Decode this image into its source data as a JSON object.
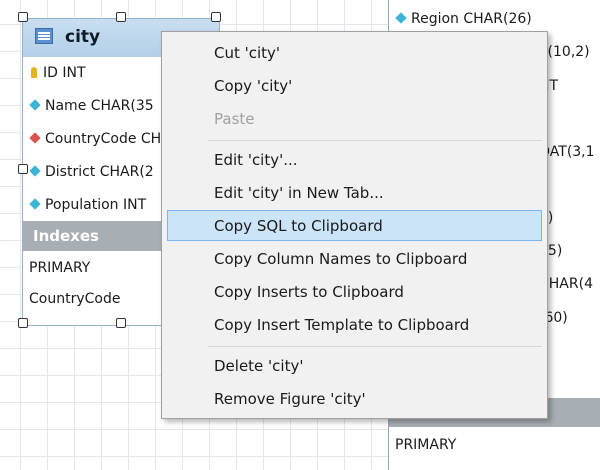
{
  "country_table": {
    "columns": [
      {
        "label": "Region CHAR(26)",
        "icon": "diamond-icon"
      },
      {
        "label": "T(10,2)"
      },
      {
        "label": "NT"
      },
      {
        "label": "OAT(3,1"
      },
      {
        "label": "2)"
      },
      {
        "label": "45)"
      },
      {
        "label": "CHAR(4"
      },
      {
        "label": "(60)"
      }
    ],
    "index_primary": "PRIMARY"
  },
  "city_table": {
    "title": "city",
    "columns": [
      {
        "label": "ID INT",
        "icon": "primary-key-icon"
      },
      {
        "label": "Name CHAR(35",
        "icon": "column-diamond-icon"
      },
      {
        "label": "CountryCode CH",
        "icon": "foreign-key-diamond-icon"
      },
      {
        "label": "District CHAR(2",
        "icon": "column-diamond-icon"
      },
      {
        "label": "Population INT",
        "icon": "column-diamond-icon"
      }
    ],
    "indexes_label": "Indexes",
    "indexes": [
      "PRIMARY",
      "CountryCode"
    ]
  },
  "context_menu": {
    "items": [
      {
        "label": "Cut 'city'",
        "disabled": false
      },
      {
        "label": "Copy 'city'",
        "disabled": false
      },
      {
        "label": "Paste",
        "disabled": true
      },
      {
        "label": "Edit 'city'...",
        "disabled": false
      },
      {
        "label": "Edit 'city' in New Tab...",
        "disabled": false
      },
      {
        "label": "Copy SQL to Clipboard",
        "disabled": false,
        "highlighted": true
      },
      {
        "label": "Copy Column Names to Clipboard",
        "disabled": false
      },
      {
        "label": "Copy Inserts to Clipboard",
        "disabled": false
      },
      {
        "label": "Copy Insert Template to Clipboard",
        "disabled": false
      },
      {
        "label": "Delete 'city'",
        "disabled": false
      },
      {
        "label": "Remove Figure 'city'",
        "disabled": false
      }
    ]
  },
  "colors": {
    "highlight": "#cce4f7",
    "highlight_border": "#7eb4ea",
    "menu_bg": "#f1f1f1",
    "indexes_header": "#a7aeb4",
    "table_header": "#b3cfe8"
  }
}
